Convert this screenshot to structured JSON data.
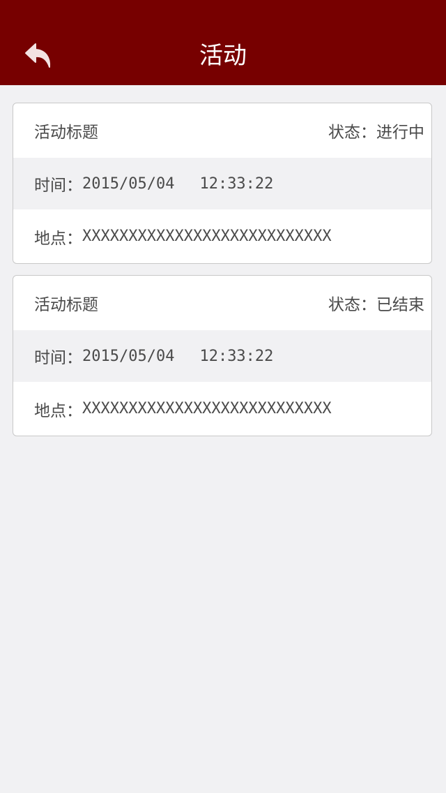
{
  "header": {
    "title": "活动",
    "back_icon": "back-arrow-icon"
  },
  "activities": [
    {
      "title": "活动标题",
      "status_label": "状态：",
      "status": "进行中",
      "time_label": "时间：",
      "date": "2015/05/04",
      "time": "12:33:22",
      "place_label": "地点：",
      "place": "XXXXXXXXXXXXXXXXXXXXXXXXXXX"
    },
    {
      "title": "活动标题",
      "status_label": "状态：",
      "status": "已结束",
      "time_label": "时间：",
      "date": "2015/05/04",
      "time": "12:33:22",
      "place_label": "地点：",
      "place": "XXXXXXXXXXXXXXXXXXXXXXXXXXX"
    }
  ],
  "colors": {
    "header_bg": "#770000",
    "page_bg": "#f1f1f3",
    "text": "#4a4a4a"
  }
}
